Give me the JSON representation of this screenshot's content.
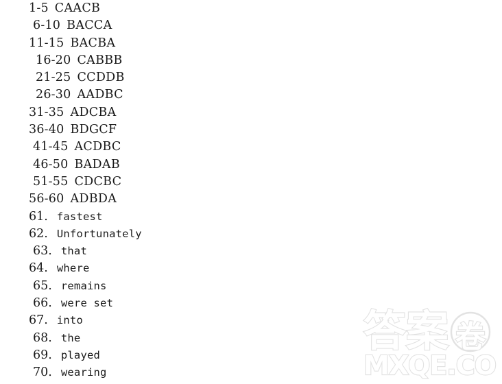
{
  "document": {
    "type": "answer-key",
    "background_color": "#ffffff",
    "text_color": "#1a1a1a"
  },
  "multiple_choice": [
    {
      "range": "1-5",
      "answers": "CAACB",
      "indent": 0
    },
    {
      "range": "6-10",
      "answers": "BACCA",
      "indent": 1
    },
    {
      "range": "11-15",
      "answers": "BACBA",
      "indent": 0
    },
    {
      "range": "16-20",
      "answers": "CABBB",
      "indent": 2
    },
    {
      "range": "21-25",
      "answers": "CCDDB",
      "indent": 2
    },
    {
      "range": "26-30",
      "answers": "AADBC",
      "indent": 2
    },
    {
      "range": "31-35",
      "answers": "ADCBA",
      "indent": 0
    },
    {
      "range": "36-40",
      "answers": "BDGCF",
      "indent": 0
    },
    {
      "range": "41-45",
      "answers": "ACDBC",
      "indent": 1
    },
    {
      "range": "46-50",
      "answers": "BADAB",
      "indent": 1
    },
    {
      "range": "51-55",
      "answers": "CDCBC",
      "indent": 1
    },
    {
      "range": "56-60",
      "answers": "ADBDA",
      "indent": 0
    }
  ],
  "written_answers": [
    {
      "number": "61.",
      "answer": "fastest",
      "indent": 0
    },
    {
      "number": "62.",
      "answer": "Unfortunately",
      "indent": 0
    },
    {
      "number": "63.",
      "answer": "that",
      "indent": 1
    },
    {
      "number": "64.",
      "answer": "where",
      "indent": 0
    },
    {
      "number": "65.",
      "answer": "remains",
      "indent": 1
    },
    {
      "number": "66.",
      "answer": "were set",
      "indent": 1
    },
    {
      "number": "67.",
      "answer": "into",
      "indent": 0
    },
    {
      "number": "68.",
      "answer": "the",
      "indent": 1
    },
    {
      "number": "69.",
      "answer": "played",
      "indent": 1
    },
    {
      "number": "70.",
      "answer": "wearing",
      "indent": 1
    }
  ],
  "watermark": {
    "cjk_text": "答案",
    "cjk_circled": "卷",
    "domain_text": "MXQE.COM",
    "color": "#e2e2e2"
  }
}
